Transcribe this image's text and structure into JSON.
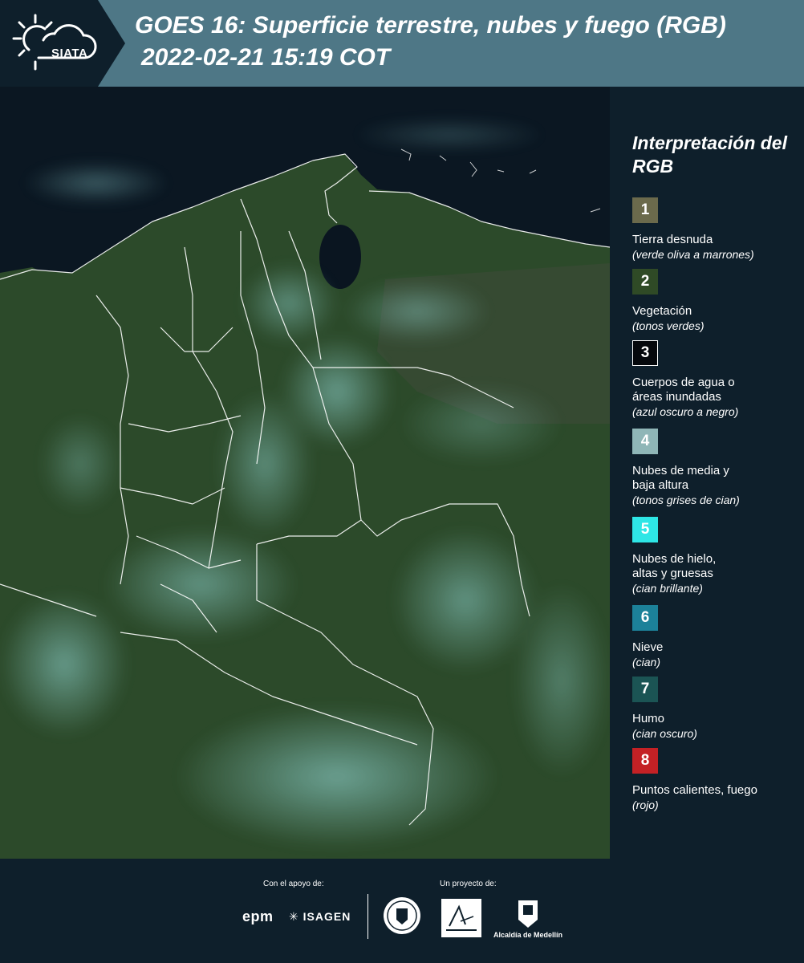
{
  "header": {
    "logo_text": "SIATA",
    "title": "GOES 16: Superficie terrestre, nubes y fuego (RGB)",
    "subtitle": "2022-02-21 15:19 COT"
  },
  "legend": {
    "title": "Interpretación del RGB",
    "items": [
      {
        "number": "1",
        "label": "Tierra desnuda",
        "desc": "(verde oliva a marrones)",
        "color": "#6b6a4c",
        "text_color": "#ffffff"
      },
      {
        "number": "2",
        "label": "Vegetación",
        "desc": "(tonos verdes)",
        "color": "#2f4a26",
        "text_color": "#ffffff"
      },
      {
        "number": "3",
        "label": "Cuerpos de agua o áreas inundadas",
        "desc": "(azul oscuro a negro)",
        "color": "#05080c",
        "text_color": "#ffffff"
      },
      {
        "number": "4",
        "label": "Nubes de media y baja altura",
        "desc": "(tonos grises de cian)",
        "color": "#8fb6b7",
        "text_color": "#ffffff"
      },
      {
        "number": "5",
        "label": "Nubes de hielo, altas y gruesas",
        "desc": "(cian brillante)",
        "color": "#2ee6e6",
        "text_color": "#ffffff"
      },
      {
        "number": "6",
        "label": "Nieve",
        "desc": "(cian)",
        "color": "#1c8199",
        "text_color": "#ffffff"
      },
      {
        "number": "7",
        "label": "Humo",
        "desc": "(cian oscuro)",
        "color": "#1b5454",
        "text_color": "#ffffff"
      },
      {
        "number": "8",
        "label": "Puntos calientes, fuego",
        "desc": "(rojo)",
        "color": "#c42125",
        "text_color": "#ffffff"
      }
    ]
  },
  "footer": {
    "support_label": "Con el apoyo de:",
    "project_label": "Un proyecto de:",
    "epm": "epm",
    "isagen": "ISAGEN",
    "alcaldia": "Alcaldía de Medellín"
  },
  "colors": {
    "background": "#0e1f2b",
    "header_band": "#4e7786",
    "ocean": "#0b1722",
    "vegetation": "#2c4a2a",
    "cloud": "#7fd4d6"
  }
}
